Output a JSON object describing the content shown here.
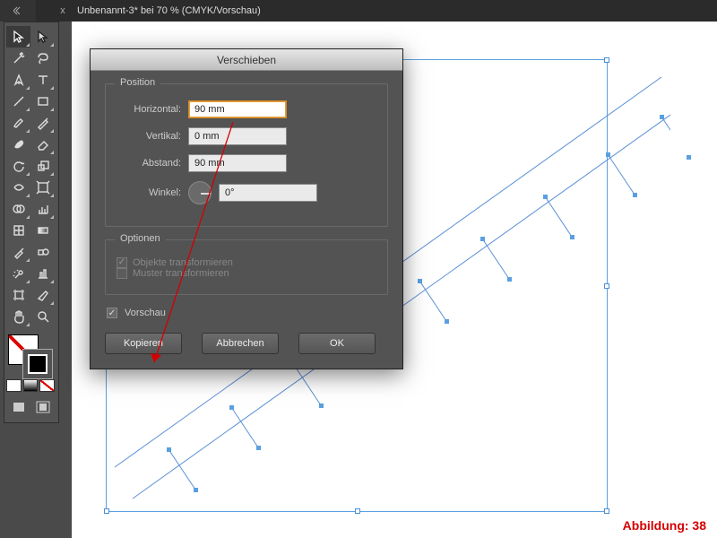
{
  "tab": {
    "close": "x",
    "title": "Unbenannt-3* bei 70 % (CMYK/Vorschau)"
  },
  "dialog": {
    "title": "Verschieben",
    "position_group": "Position",
    "horizontal_label": "Horizontal:",
    "horizontal_value": "90 mm",
    "vertical_label": "Vertikal:",
    "vertical_value": "0 mm",
    "distance_label": "Abstand:",
    "distance_value": "90 mm",
    "angle_label": "Winkel:",
    "angle_value": "0°",
    "options_group": "Optionen",
    "opt_objects": "Objekte transformieren",
    "opt_patterns": "Muster transformieren",
    "preview_label": "Vorschau",
    "btn_copy": "Kopieren",
    "btn_cancel": "Abbrechen",
    "btn_ok": "OK"
  },
  "caption": "Abbildung: 38",
  "tools": [
    "selection",
    "direct-selection",
    "magic-wand",
    "lasso",
    "pen",
    "type",
    "line",
    "rectangle",
    "brush",
    "pencil",
    "blob",
    "eraser",
    "rotate",
    "scale",
    "width",
    "warp",
    "shape-builder",
    "perspective",
    "mesh",
    "gradient",
    "eyedropper",
    "blend",
    "symbol-sprayer",
    "graph",
    "artboard",
    "slice",
    "hand",
    "zoom"
  ]
}
